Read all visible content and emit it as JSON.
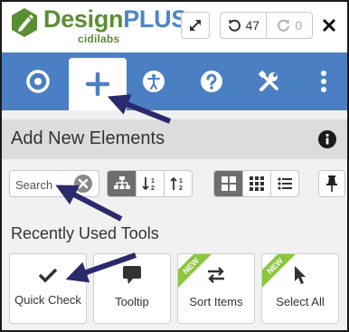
{
  "brand": {
    "name_part1": "Design",
    "name_part2": "PLUS",
    "sub": "cidilabs"
  },
  "header": {
    "expand_icon": "expand-arrows-icon",
    "undo_count": "47",
    "redo_count": "0",
    "close_icon": "close-x-icon"
  },
  "toolbar": {
    "items": [
      {
        "icon": "target-icon",
        "active": false
      },
      {
        "icon": "plus-icon",
        "active": true
      },
      {
        "icon": "accessibility-icon",
        "active": false
      },
      {
        "icon": "help-icon",
        "active": false
      },
      {
        "icon": "tools-icon",
        "active": false
      },
      {
        "icon": "more-vertical-icon",
        "active": false
      }
    ]
  },
  "section": {
    "title": "Add New Elements"
  },
  "search": {
    "placeholder": "Search",
    "value": ""
  },
  "recent": {
    "title": "Recently Used Tools",
    "tools": [
      {
        "label": "Quick Check",
        "icon": "checkmark-icon",
        "badge": ""
      },
      {
        "label": "Tooltip",
        "icon": "speech-bubble-icon",
        "badge": ""
      },
      {
        "label": "Sort Items",
        "icon": "swap-arrows-icon",
        "badge": "NEW"
      },
      {
        "label": "Select All",
        "icon": "cursor-icon",
        "badge": "NEW"
      }
    ]
  },
  "colors": {
    "brand_green": "#5a8e33",
    "brand_blue": "#4d86c6",
    "toolbar_blue": "#4b7fc4",
    "badge_green": "#8cc63f",
    "annotation_arrow": "#2b2a6e"
  }
}
